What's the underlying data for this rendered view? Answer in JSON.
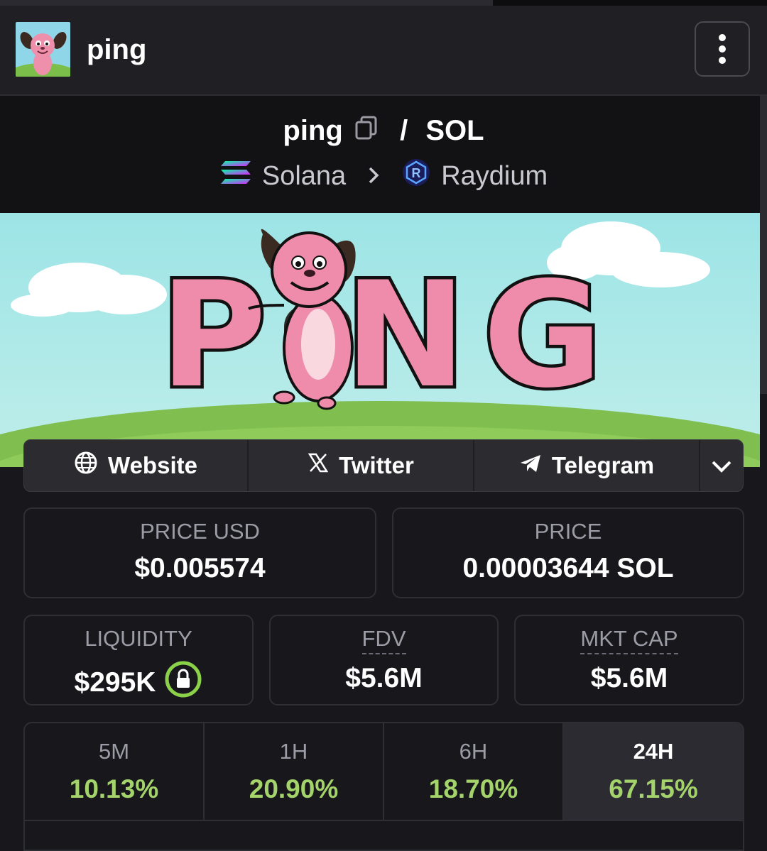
{
  "header": {
    "title": "ping"
  },
  "pair": {
    "base": "ping",
    "separator": "/",
    "quote": "SOL",
    "chain": "Solana",
    "dex": "Raydium"
  },
  "banner": {
    "text": "PING"
  },
  "links": [
    {
      "label": "Website",
      "icon": "globe-icon"
    },
    {
      "label": "Twitter",
      "icon": "x-icon"
    },
    {
      "label": "Telegram",
      "icon": "telegram-icon"
    }
  ],
  "price_usd": {
    "label": "PRICE USD",
    "value": "$0.005574"
  },
  "price": {
    "label": "PRICE",
    "value": "0.00003644 SOL"
  },
  "liquidity": {
    "label": "LIQUIDITY",
    "value": "$295K"
  },
  "fdv": {
    "label": "FDV",
    "value": "$5.6M"
  },
  "mkt_cap": {
    "label": "MKT CAP",
    "value": "$5.6M"
  },
  "changes": [
    {
      "label": "5M",
      "value": "10.13%"
    },
    {
      "label": "1H",
      "value": "20.90%"
    },
    {
      "label": "6H",
      "value": "18.70%"
    },
    {
      "label": "24H",
      "value": "67.15%"
    }
  ],
  "colors": {
    "positive": "#a3d36a",
    "background": "#17171c",
    "lock": "#8bd14a"
  }
}
